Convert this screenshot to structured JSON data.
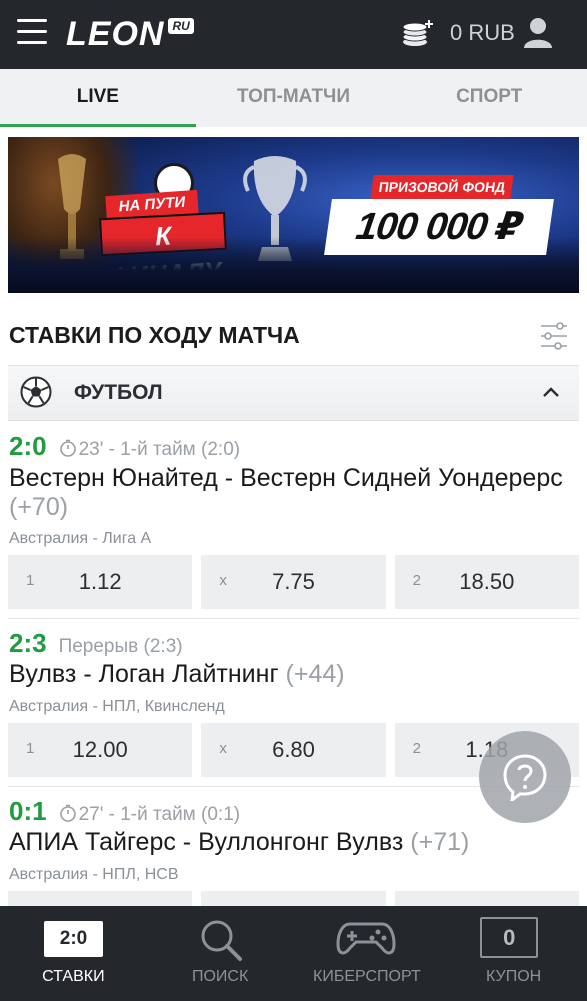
{
  "header": {
    "logo": "LEON",
    "logo_suffix": "RU",
    "balance": "0 RUB",
    "icons": [
      "menu-icon",
      "coins-icon",
      "user-icon"
    ]
  },
  "tabs": [
    {
      "label": "LIVE",
      "active": true
    },
    {
      "label": "ТОП-МАТЧИ",
      "active": false
    },
    {
      "label": "СПОРТ",
      "active": false
    }
  ],
  "banner": {
    "emblem_top": "НА ПУТИ",
    "emblem_bottom": "К ФИНАЛУ",
    "prize_label": "ПРИЗОВОЙ ФОНД",
    "prize_amount": "100 000 ₽"
  },
  "section": {
    "title": "СТАВКИ ПО ХОДУ МАТЧА"
  },
  "sport": {
    "name": "ФУТБОЛ"
  },
  "matches": [
    {
      "score": "2:0",
      "time": "23' - 1-й тайм (2:0)",
      "title": "Вестерн Юнайтед - Вестерн Сидней Уондерерс",
      "more": "(+70)",
      "league": "Австралия - Лига А",
      "odds": [
        {
          "key": "1",
          "value": "1.12"
        },
        {
          "key": "x",
          "value": "7.75"
        },
        {
          "key": "2",
          "value": "18.50"
        }
      ]
    },
    {
      "score": "2:3",
      "time": "Перерыв (2:3)",
      "title": "Вулвз - Логан Лайтнинг",
      "more": "(+44)",
      "league": "Австралия - НПЛ, Квинсленд",
      "odds": [
        {
          "key": "1",
          "value": "12.00"
        },
        {
          "key": "x",
          "value": "6.80"
        },
        {
          "key": "2",
          "value": "1.18"
        }
      ]
    },
    {
      "score": "0:1",
      "time": "27' - 1-й тайм (0:1)",
      "title": "АПИА Тайгерс - Вуллонгонг Вулвз",
      "more": "(+71)",
      "league": "Австралия - НПЛ, НСВ"
    }
  ],
  "bottom_nav": [
    {
      "label": "СТАВКИ",
      "badge": "2:0",
      "active": true
    },
    {
      "label": "ПОИСК",
      "active": false
    },
    {
      "label": "КИБЕРСПОРТ",
      "active": false
    },
    {
      "label": "КУПОН",
      "badge": "0",
      "active": false
    }
  ],
  "colors": {
    "header_bg": "#24272c",
    "accent_green": "#1e9c3f",
    "tab_underline": "#2ea44f",
    "odd_bg": "#edeef0",
    "banner_red": "#e5262b"
  }
}
